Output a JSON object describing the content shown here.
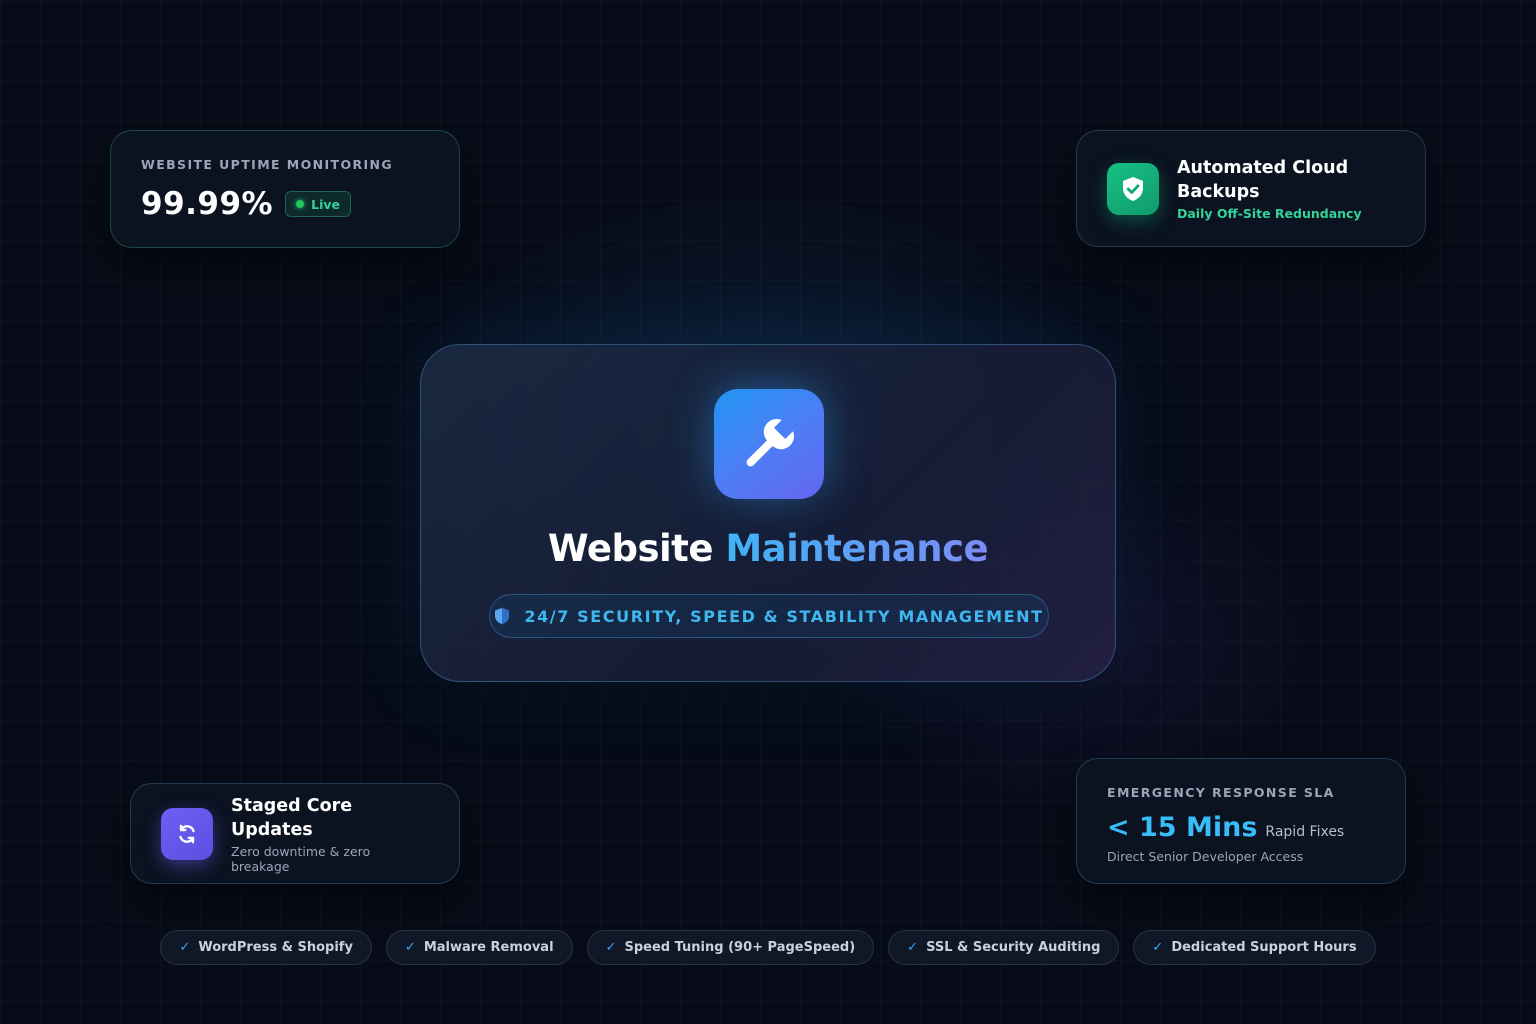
{
  "uptime": {
    "label": "WEBSITE UPTIME MONITORING",
    "value": "99.99%",
    "badge": "Live"
  },
  "backup": {
    "icon": "shield-check-icon",
    "title_line1": "Automated Cloud",
    "title_line2": "Backups",
    "subtitle": "Daily Off-Site Redundancy"
  },
  "main": {
    "icon": "wrench-icon",
    "title_part1": "Website",
    "title_part2": "Maintenance",
    "pill_icon": "shield-icon",
    "pill_text": "24/7 SECURITY, SPEED & STABILITY MANAGEMENT"
  },
  "staged": {
    "icon": "refresh-icon",
    "title": "Staged Core Updates",
    "subtitle": "Zero downtime & zero breakage"
  },
  "sla": {
    "label": "EMERGENCY RESPONSE SLA",
    "value": "< 15 Mins",
    "suffix": "Rapid Fixes",
    "footnote": "Direct Senior Developer Access"
  },
  "features": [
    {
      "check": "✓",
      "label": "WordPress & Shopify"
    },
    {
      "check": "✓",
      "label": "Malware Removal"
    },
    {
      "check": "✓",
      "label": "Speed Tuning (90+ PageSpeed)"
    },
    {
      "check": "✓",
      "label": "SSL & Security Auditing"
    },
    {
      "check": "✓",
      "label": "Dedicated Support Hours"
    }
  ],
  "colors": {
    "background": "#070c18",
    "accent_blue": "#38bdf8",
    "accent_green": "#34d399",
    "accent_purple": "#6366f1"
  }
}
